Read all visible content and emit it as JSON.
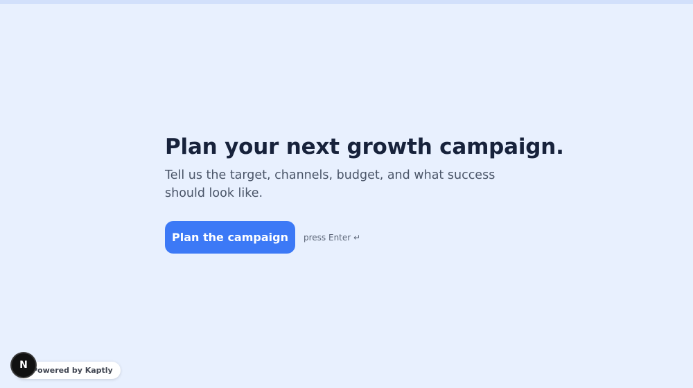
{
  "hero": {
    "title": "Plan your next growth campaign.",
    "subtitle": "Tell us the target, channels, budget, and what success should look like.",
    "primary_button_label": "Plan the campaign",
    "enter_hint": "press Enter ↵"
  },
  "footer": {
    "logo_letter": "N",
    "powered_by": "Powered by Kaptly"
  },
  "colors": {
    "background": "#e8f0fe",
    "accent": "#3c79f6",
    "heading": "#17223b"
  }
}
